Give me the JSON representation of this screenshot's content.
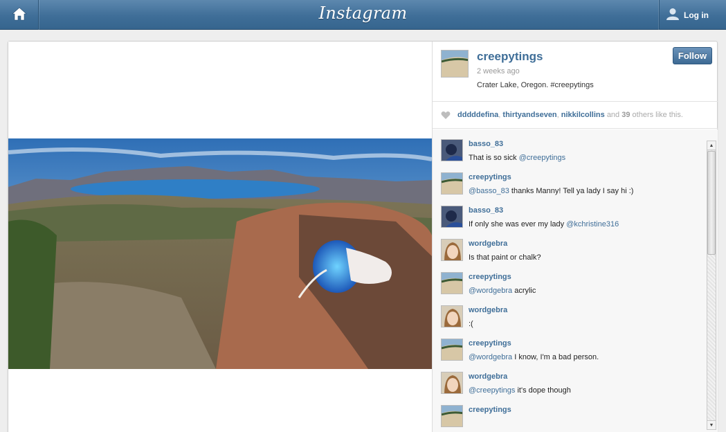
{
  "header": {
    "logo": "Instagram",
    "login_label": "Log in"
  },
  "post": {
    "owner": "creepytings",
    "time": "2 weeks ago",
    "caption": "Crater Lake, Oregon. #creepytings",
    "follow_label": "Follow",
    "likes": {
      "users": [
        "dddddefina",
        "thirtyandseven",
        "nikkilcollins"
      ],
      "and_text": "and",
      "others_count": "39",
      "others_text": "others like this."
    }
  },
  "comments": [
    {
      "user": "basso_83",
      "mention": "",
      "text": "That is so sick ",
      "mention_after": "@creepytings",
      "avatar": "photo-blue"
    },
    {
      "user": "creepytings",
      "mention": "@basso_83",
      "text": " thanks Manny! Tell ya lady I say hi :)",
      "mention_after": "",
      "avatar": "photo-rock"
    },
    {
      "user": "basso_83",
      "mention": "",
      "text": "If only she was ever my lady ",
      "mention_after": "@kchristine316",
      "avatar": "photo-blue"
    },
    {
      "user": "wordgebra",
      "mention": "",
      "text": "Is that paint or chalk?",
      "mention_after": "",
      "avatar": "photo-face"
    },
    {
      "user": "creepytings",
      "mention": "@wordgebra",
      "text": " acrylic",
      "mention_after": "",
      "avatar": "photo-rock"
    },
    {
      "user": "wordgebra",
      "mention": "",
      "text": ":(",
      "mention_after": "",
      "avatar": "photo-face"
    },
    {
      "user": "creepytings",
      "mention": "@wordgebra",
      "text": " I know, I'm a bad person.",
      "mention_after": "",
      "avatar": "photo-rock"
    },
    {
      "user": "wordgebra",
      "mention": "@creepytings",
      "text": " it's dope though",
      "mention_after": "",
      "avatar": "photo-face"
    },
    {
      "user": "creepytings",
      "mention": "",
      "text": "",
      "mention_after": "",
      "avatar": "photo-rock"
    }
  ],
  "icons": {
    "home": "home-icon",
    "login": "user-icon",
    "like": "heart-icon"
  },
  "colors": {
    "accent": "#3f6e98",
    "topbar": "#4b79a1"
  }
}
